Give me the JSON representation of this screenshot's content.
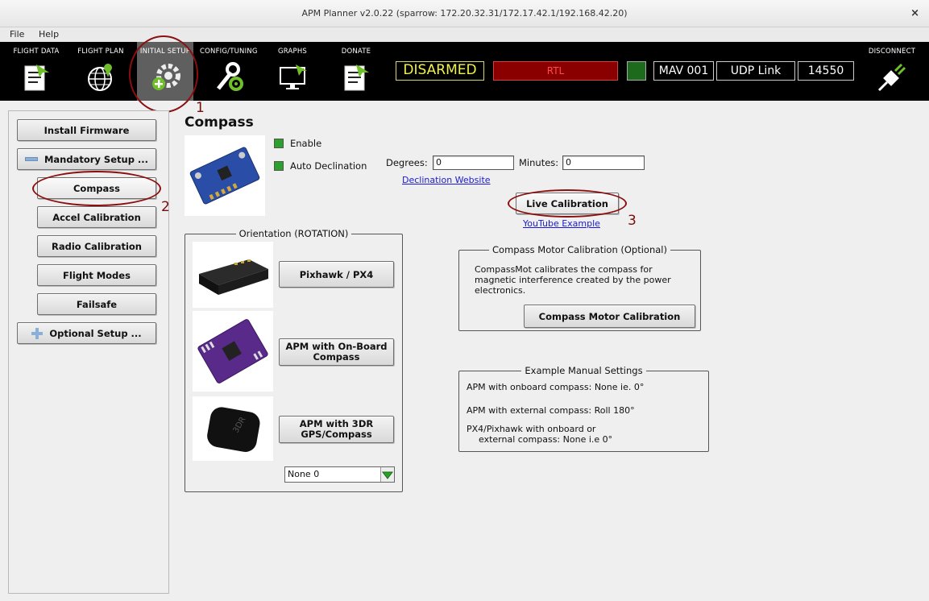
{
  "window": {
    "title": "APM Planner v2.0.22 (sparrow: 172.20.32.31/172.17.42.1/192.168.42.20)",
    "close_glyph": "×"
  },
  "menu": {
    "items": [
      "File",
      "Help"
    ]
  },
  "toolbar": {
    "buttons": [
      {
        "label": "FLIGHT DATA",
        "icon": "flight-data-icon"
      },
      {
        "label": "FLIGHT PLAN",
        "icon": "flight-plan-icon"
      },
      {
        "label": "INITIAL SETUP",
        "icon": "initial-setup-icon"
      },
      {
        "label": "CONFIG/TUNING",
        "icon": "config-tuning-icon"
      },
      {
        "label": "GRAPHS",
        "icon": "graphs-icon"
      },
      {
        "label": "DONATE",
        "icon": "donate-icon"
      }
    ],
    "disconnect": "DISCONNECT",
    "status": {
      "armed": "DISARMED",
      "mode": "RTL",
      "mav": "MAV 001",
      "link": "UDP Link",
      "port": "14550"
    }
  },
  "sidebar": {
    "install_firmware": "Install Firmware",
    "mandatory_setup": "Mandatory Setup ...",
    "items": [
      "Compass",
      "Accel Calibration",
      "Radio Calibration",
      "Flight Modes",
      "Failsafe"
    ],
    "optional_setup": "Optional Setup ..."
  },
  "annotations": [
    "1",
    "2",
    "3"
  ],
  "compass": {
    "title": "Compass",
    "enable_label": "Enable",
    "auto_declination_label": "Auto Declination",
    "degrees_label": "Degrees:",
    "degrees_value": "0",
    "minutes_label": "Minutes:",
    "minutes_value": "0",
    "declination_link": "Declination Website",
    "live_calibration": "Live Calibration",
    "youtube_link": "YouTube Example",
    "orientation": {
      "title": "Orientation (ROTATION)",
      "buttons": [
        "Pixhawk / PX4",
        "APM with On-Board Compass",
        "APM with 3DR GPS/Compass"
      ],
      "select_value": "None 0"
    },
    "motor": {
      "title": "Compass Motor Calibration (Optional)",
      "description": "CompassMot calibrates the compass for magnetic interference created by the power electronics.",
      "button": "Compass Motor Calibration"
    },
    "examples": {
      "title": "Example Manual Settings",
      "lines": [
        "APM with onboard compass: None ie. 0°",
        "APM with external compass: Roll 180°",
        "PX4/Pixhawk with onboard or",
        "external compass: None i.e 0°"
      ]
    }
  },
  "colors": {
    "toolbar_bg": "#000000",
    "active_tab": "#5f5f5f",
    "disarmed": "#f2f24a",
    "rtl_bg": "#8a0000",
    "annotation": "#8b0f0f",
    "check": "#2aa12a"
  }
}
